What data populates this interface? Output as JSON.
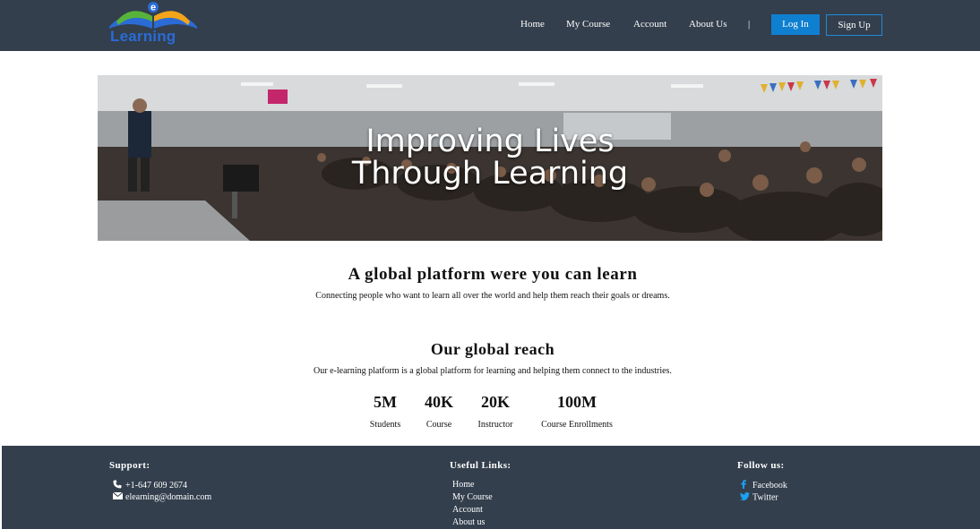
{
  "brand": {
    "logo_letter": "e",
    "logo_word": "Learning",
    "colors": {
      "blue": "#2a6bd6",
      "green": "#58b33a",
      "orange": "#f2a51a"
    }
  },
  "nav": {
    "links": [
      "Home",
      "My Course",
      "Account",
      "About Us"
    ],
    "separator": "|",
    "login_label": "Log In",
    "signup_label": "Sign Up"
  },
  "hero": {
    "title_line1": "Improving Lives",
    "title_line2": "Through Learning"
  },
  "platform": {
    "heading": "A global platform were you can learn",
    "text": "Connecting people who want to learn all over the world and help them reach their goals or dreams."
  },
  "reach": {
    "heading": "Our global reach",
    "text": "Our e-learning platform is a global platform for learning and helping them connect to the industries.",
    "stats": [
      {
        "value": "5M",
        "label": "Students"
      },
      {
        "value": "40K",
        "label": "Course"
      },
      {
        "value": "20K",
        "label": "Instructor"
      },
      {
        "value": "100M",
        "label": "Course Enrollments"
      }
    ]
  },
  "footer": {
    "support": {
      "heading": "Support:",
      "phone": "+1-647 609 2674",
      "email": "elearning@domain.com"
    },
    "useful_links": {
      "heading": "Useful Links:",
      "links": [
        "Home",
        "My Course",
        "Account",
        "About us"
      ]
    },
    "follow": {
      "heading": "Follow us:",
      "facebook": "Facebook",
      "twitter": "Twitter"
    }
  },
  "colors": {
    "navbar": "#333f4d",
    "footer": "#333f4d",
    "login_button": "#0f7fd0",
    "signup_border": "#1f8ad8",
    "social_icon": "#1da1f2"
  }
}
